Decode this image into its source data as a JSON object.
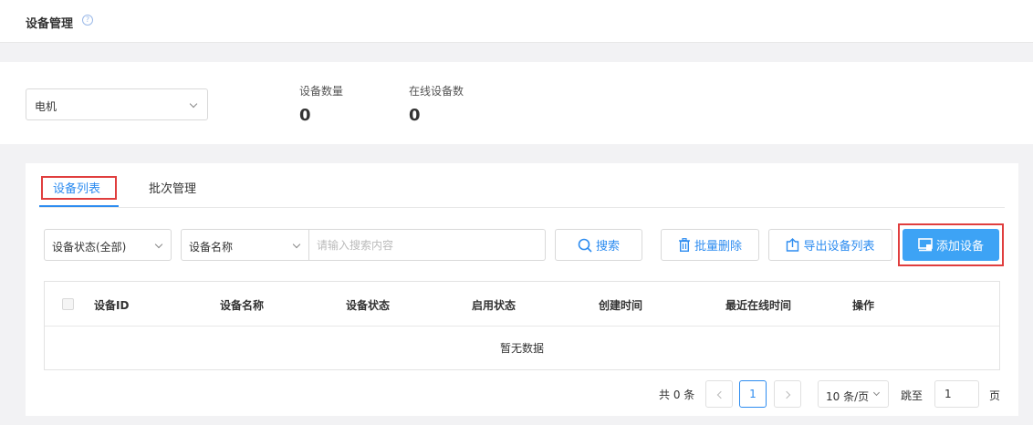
{
  "header": {
    "title": "设备管理"
  },
  "stats": {
    "product_selected": "电机",
    "device_count_label": "设备数量",
    "device_count": "0",
    "online_count_label": "在线设备数",
    "online_count": "0"
  },
  "tabs": [
    {
      "label": "设备列表",
      "active": true
    },
    {
      "label": "批次管理",
      "active": false
    }
  ],
  "toolbar": {
    "status_filter": "设备状态(全部)",
    "field_filter": "设备名称",
    "search_placeholder": "请输入搜索内容",
    "search_label": "搜索",
    "batch_delete_label": "批量删除",
    "export_label": "导出设备列表",
    "add_label": "添加设备"
  },
  "table": {
    "columns": [
      "设备ID",
      "设备名称",
      "设备状态",
      "启用状态",
      "创建时间",
      "最近在线时间",
      "操作"
    ],
    "empty_text": "暂无数据"
  },
  "pagination": {
    "total_text": "共 0 条",
    "current_page": "1",
    "page_size": "10 条/页",
    "jump_label": "跳至",
    "jump_value": "1",
    "page_suffix": "页"
  },
  "colors": {
    "accent": "#2d8cf0",
    "primary_button": "#3da3f5",
    "highlight_box": "#e03e3e"
  }
}
